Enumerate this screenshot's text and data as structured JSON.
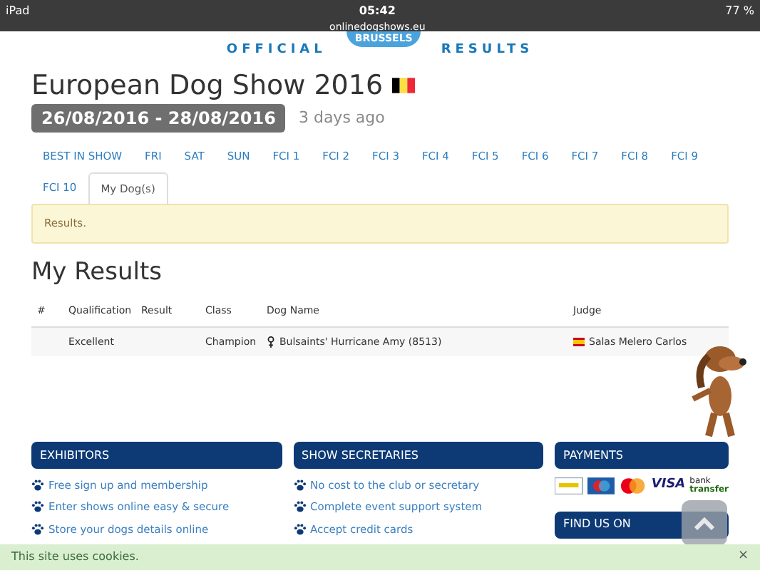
{
  "status_bar": {
    "device": "iPad",
    "time": "05:42",
    "url": "onlinedogshows.eu",
    "battery": "77 %"
  },
  "logo": {
    "city": "BRUSSELS",
    "left": "OFFICIAL",
    "right": "RESULTS"
  },
  "event": {
    "title": "European Dog Show 2016",
    "dates": "26/08/2016 - 28/08/2016",
    "ago": "3 days ago"
  },
  "tabs": [
    {
      "label": "BEST IN SHOW",
      "selected": false
    },
    {
      "label": "FRI",
      "selected": false
    },
    {
      "label": "SAT",
      "selected": false
    },
    {
      "label": "SUN",
      "selected": false
    },
    {
      "label": "FCI 1",
      "selected": false
    },
    {
      "label": "FCI 2",
      "selected": false
    },
    {
      "label": "FCI 3",
      "selected": false
    },
    {
      "label": "FCI 4",
      "selected": false
    },
    {
      "label": "FCI 5",
      "selected": false
    },
    {
      "label": "FCI 6",
      "selected": false
    },
    {
      "label": "FCI 7",
      "selected": false
    },
    {
      "label": "FCI 8",
      "selected": false
    },
    {
      "label": "FCI 9",
      "selected": false
    },
    {
      "label": "FCI 10",
      "selected": false
    },
    {
      "label": "My Dog(s)",
      "selected": true
    }
  ],
  "alert": "Results.",
  "results": {
    "heading": "My Results",
    "columns": [
      "#",
      "Qualification",
      "Result",
      "Class",
      "Dog Name",
      "Judge"
    ],
    "rows": [
      {
        "number": "",
        "qualification": "Excellent",
        "result": "",
        "class": "Champion",
        "dog_name": "Bulsaints' Hurricane Amy (8513)",
        "judge": "Salas Melero Carlos"
      }
    ]
  },
  "footer": [
    {
      "kind": "list",
      "title": "EXHIBITORS",
      "items": [
        "Free sign up and membership",
        "Enter shows online easy & secure",
        "Store your dogs details online"
      ]
    },
    {
      "kind": "list",
      "title": "SHOW SECRETARIES",
      "items": [
        "No cost to the club or secretary",
        "Complete event support system",
        "Accept credit cards"
      ]
    },
    {
      "kind": "payments",
      "title": "PAYMENTS",
      "labels": [
        "VISA",
        "bank",
        "transfer"
      ],
      "next_title": "FIND US ON"
    }
  ],
  "cookie_bar": {
    "text": "This site uses cookies.",
    "close": "×"
  }
}
